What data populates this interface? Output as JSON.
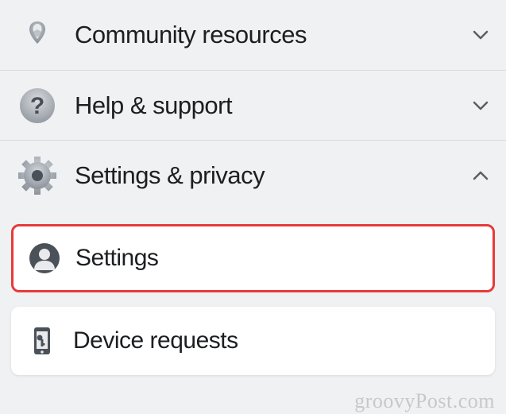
{
  "menu": {
    "items": [
      {
        "id": "community",
        "label": "Community resources",
        "expanded": false
      },
      {
        "id": "help",
        "label": "Help & support",
        "expanded": false
      },
      {
        "id": "settings_privacy",
        "label": "Settings & privacy",
        "expanded": true
      }
    ]
  },
  "sub_items": [
    {
      "id": "settings",
      "label": "Settings",
      "highlighted": true
    },
    {
      "id": "device_requests",
      "label": "Device requests",
      "highlighted": false
    }
  ],
  "watermark": "groovyPost.com"
}
